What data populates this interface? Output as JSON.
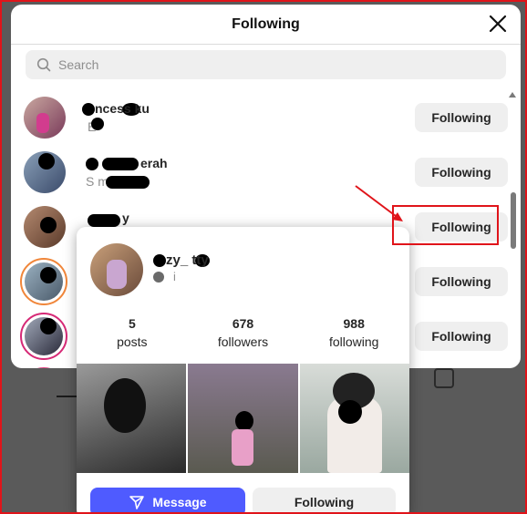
{
  "modal": {
    "title": "Following",
    "close_icon": "close-icon"
  },
  "search": {
    "placeholder": "Search",
    "icon": "search-icon"
  },
  "list": {
    "items": [
      {
        "name": "ncess  ku",
        "sub": "E",
        "button": "Following",
        "story": false
      },
      {
        "name": "   erah",
        "sub": "S   m",
        "button": "Following",
        "story": false
      },
      {
        "name": "  y",
        "sub": "",
        "button": "Following",
        "story": false
      },
      {
        "name": "",
        "sub": "",
        "button": "Following",
        "story": true
      },
      {
        "name": "",
        "sub": "",
        "button": "Following",
        "story": true
      }
    ]
  },
  "hover_card": {
    "username": "zy_ tty",
    "sub": "i",
    "stats": [
      {
        "value": "5",
        "label": "posts"
      },
      {
        "value": "678",
        "label": "followers"
      },
      {
        "value": "988",
        "label": "following"
      }
    ],
    "message_label": "Message",
    "message_icon": "send-icon",
    "following_label": "Following"
  },
  "colors": {
    "annotation": "#e0141a",
    "message_button": "#4f5bff",
    "story_ring": "#d62976",
    "button_bg": "#efefef"
  }
}
